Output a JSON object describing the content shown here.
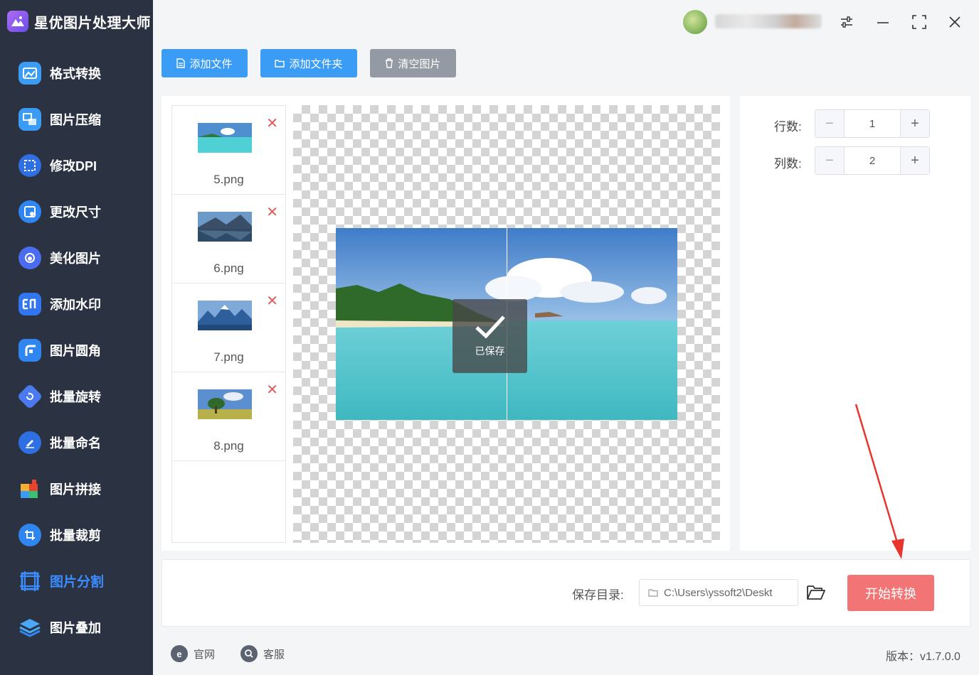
{
  "app": {
    "title": "星优图片处理大师"
  },
  "sidebar": {
    "items": [
      {
        "label": "格式转换",
        "icon": "image-convert-icon",
        "color": "#3b9cf5"
      },
      {
        "label": "图片压缩",
        "icon": "image-compress-icon",
        "color": "#3b9cf5"
      },
      {
        "label": "修改DPI",
        "icon": "dpi-icon",
        "color": "#2f6fe4"
      },
      {
        "label": "更改尺寸",
        "icon": "resize-icon",
        "color": "#2f86f0"
      },
      {
        "label": "美化图片",
        "icon": "beautify-icon",
        "color": "#4a6cf0"
      },
      {
        "label": "添加水印",
        "icon": "watermark-icon",
        "color": "#3176f0"
      },
      {
        "label": "图片圆角",
        "icon": "rounded-corner-icon",
        "color": "#2f86f0"
      },
      {
        "label": "批量旋转",
        "icon": "rotate-icon",
        "color": "#4a79f0"
      },
      {
        "label": "批量命名",
        "icon": "rename-icon",
        "color": "#2f6fe4"
      },
      {
        "label": "图片拼接",
        "icon": "puzzle-icon",
        "color": "#f0a030"
      },
      {
        "label": "批量裁剪",
        "icon": "crop-icon",
        "color": "#2f86f0"
      },
      {
        "label": "图片分割",
        "icon": "split-grid-icon",
        "color": "#3b8cff",
        "active": true
      },
      {
        "label": "图片叠加",
        "icon": "layers-icon",
        "color": "#3b9cf5"
      }
    ]
  },
  "toolbar": {
    "add_file": "添加文件",
    "add_folder": "添加文件夹",
    "clear_images": "清空图片"
  },
  "files": [
    {
      "name": "5.png",
      "thumb": "beach"
    },
    {
      "name": "6.png",
      "thumb": "lake"
    },
    {
      "name": "7.png",
      "thumb": "mountains"
    },
    {
      "name": "8.png",
      "thumb": "tree"
    }
  ],
  "preview": {
    "status": "已保存"
  },
  "settings": {
    "rows_label": "行数:",
    "rows_value": "1",
    "cols_label": "列数:",
    "cols_value": "2",
    "minus": "−",
    "plus": "+"
  },
  "output": {
    "save_dir_label": "保存目录:",
    "save_dir_value": "C:\\Users\\yssoft2\\Deskt",
    "start_button": "开始转换"
  },
  "footer": {
    "website": "官网",
    "support": "客服",
    "version": "版本：v1.7.0.0"
  },
  "colors": {
    "primary": "#3b9cf5",
    "danger": "#f27474",
    "sidebar_bg": "#2b3342",
    "annotation_arrow": "#e8352e"
  }
}
